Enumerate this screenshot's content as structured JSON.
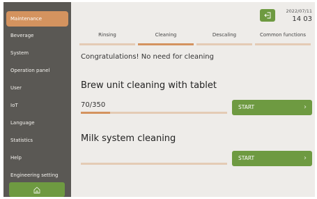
{
  "sidebar": {
    "items": [
      {
        "label": "Maintenance",
        "active": true
      },
      {
        "label": "Beverage"
      },
      {
        "label": "System"
      },
      {
        "label": "Operation panel"
      },
      {
        "label": "User"
      },
      {
        "label": "IoT"
      },
      {
        "label": "Language"
      },
      {
        "label": "Statistics"
      },
      {
        "label": "Help"
      },
      {
        "label": "Engineering setting"
      }
    ],
    "home_icon": "home-icon"
  },
  "header": {
    "back_icon": "exit-icon",
    "date": "2022/07/11",
    "time": "14 03"
  },
  "tabs": [
    {
      "label": "Rinsing"
    },
    {
      "label": "Cleaning",
      "active": true
    },
    {
      "label": "Descaling"
    },
    {
      "label": "Common functions"
    }
  ],
  "main": {
    "message": "Congratulations! No need for cleaning",
    "brew": {
      "title": "Brew unit cleaning with tablet",
      "counter": "70/350",
      "progress": 0.2,
      "start_label": "START"
    },
    "milk": {
      "title": "Milk system cleaning",
      "progress": 0,
      "start_label": "START"
    }
  },
  "colors": {
    "accent": "#d4935f",
    "green": "#6e9a41",
    "sidebar": "#5a5854",
    "background": "#eeece9"
  }
}
